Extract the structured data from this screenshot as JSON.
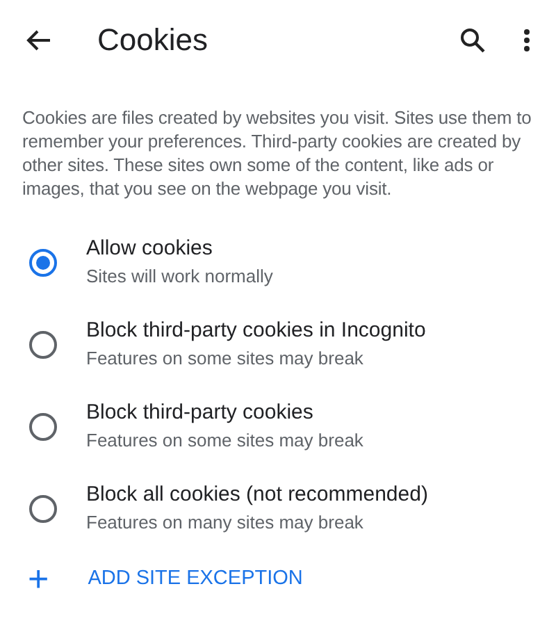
{
  "app_bar": {
    "title": "Cookies"
  },
  "description": "Cookies are files created by websites you visit. Sites use them to remember your preferences. Third-party cookies are created by other sites. These sites own some of the content, like ads or images, that you see on the webpage you visit.",
  "options": [
    {
      "title": "Allow cookies",
      "subtitle": "Sites will work normally",
      "selected": true
    },
    {
      "title": "Block third-party cookies in Incognito",
      "subtitle": "Features on some sites may break",
      "selected": false
    },
    {
      "title": "Block third-party cookies",
      "subtitle": "Features on some sites may break",
      "selected": false
    },
    {
      "title": "Block all cookies (not recommended)",
      "subtitle": "Features on many sites may break",
      "selected": false
    }
  ],
  "add_exception": {
    "icon": "+",
    "label": "ADD SITE EXCEPTION"
  }
}
